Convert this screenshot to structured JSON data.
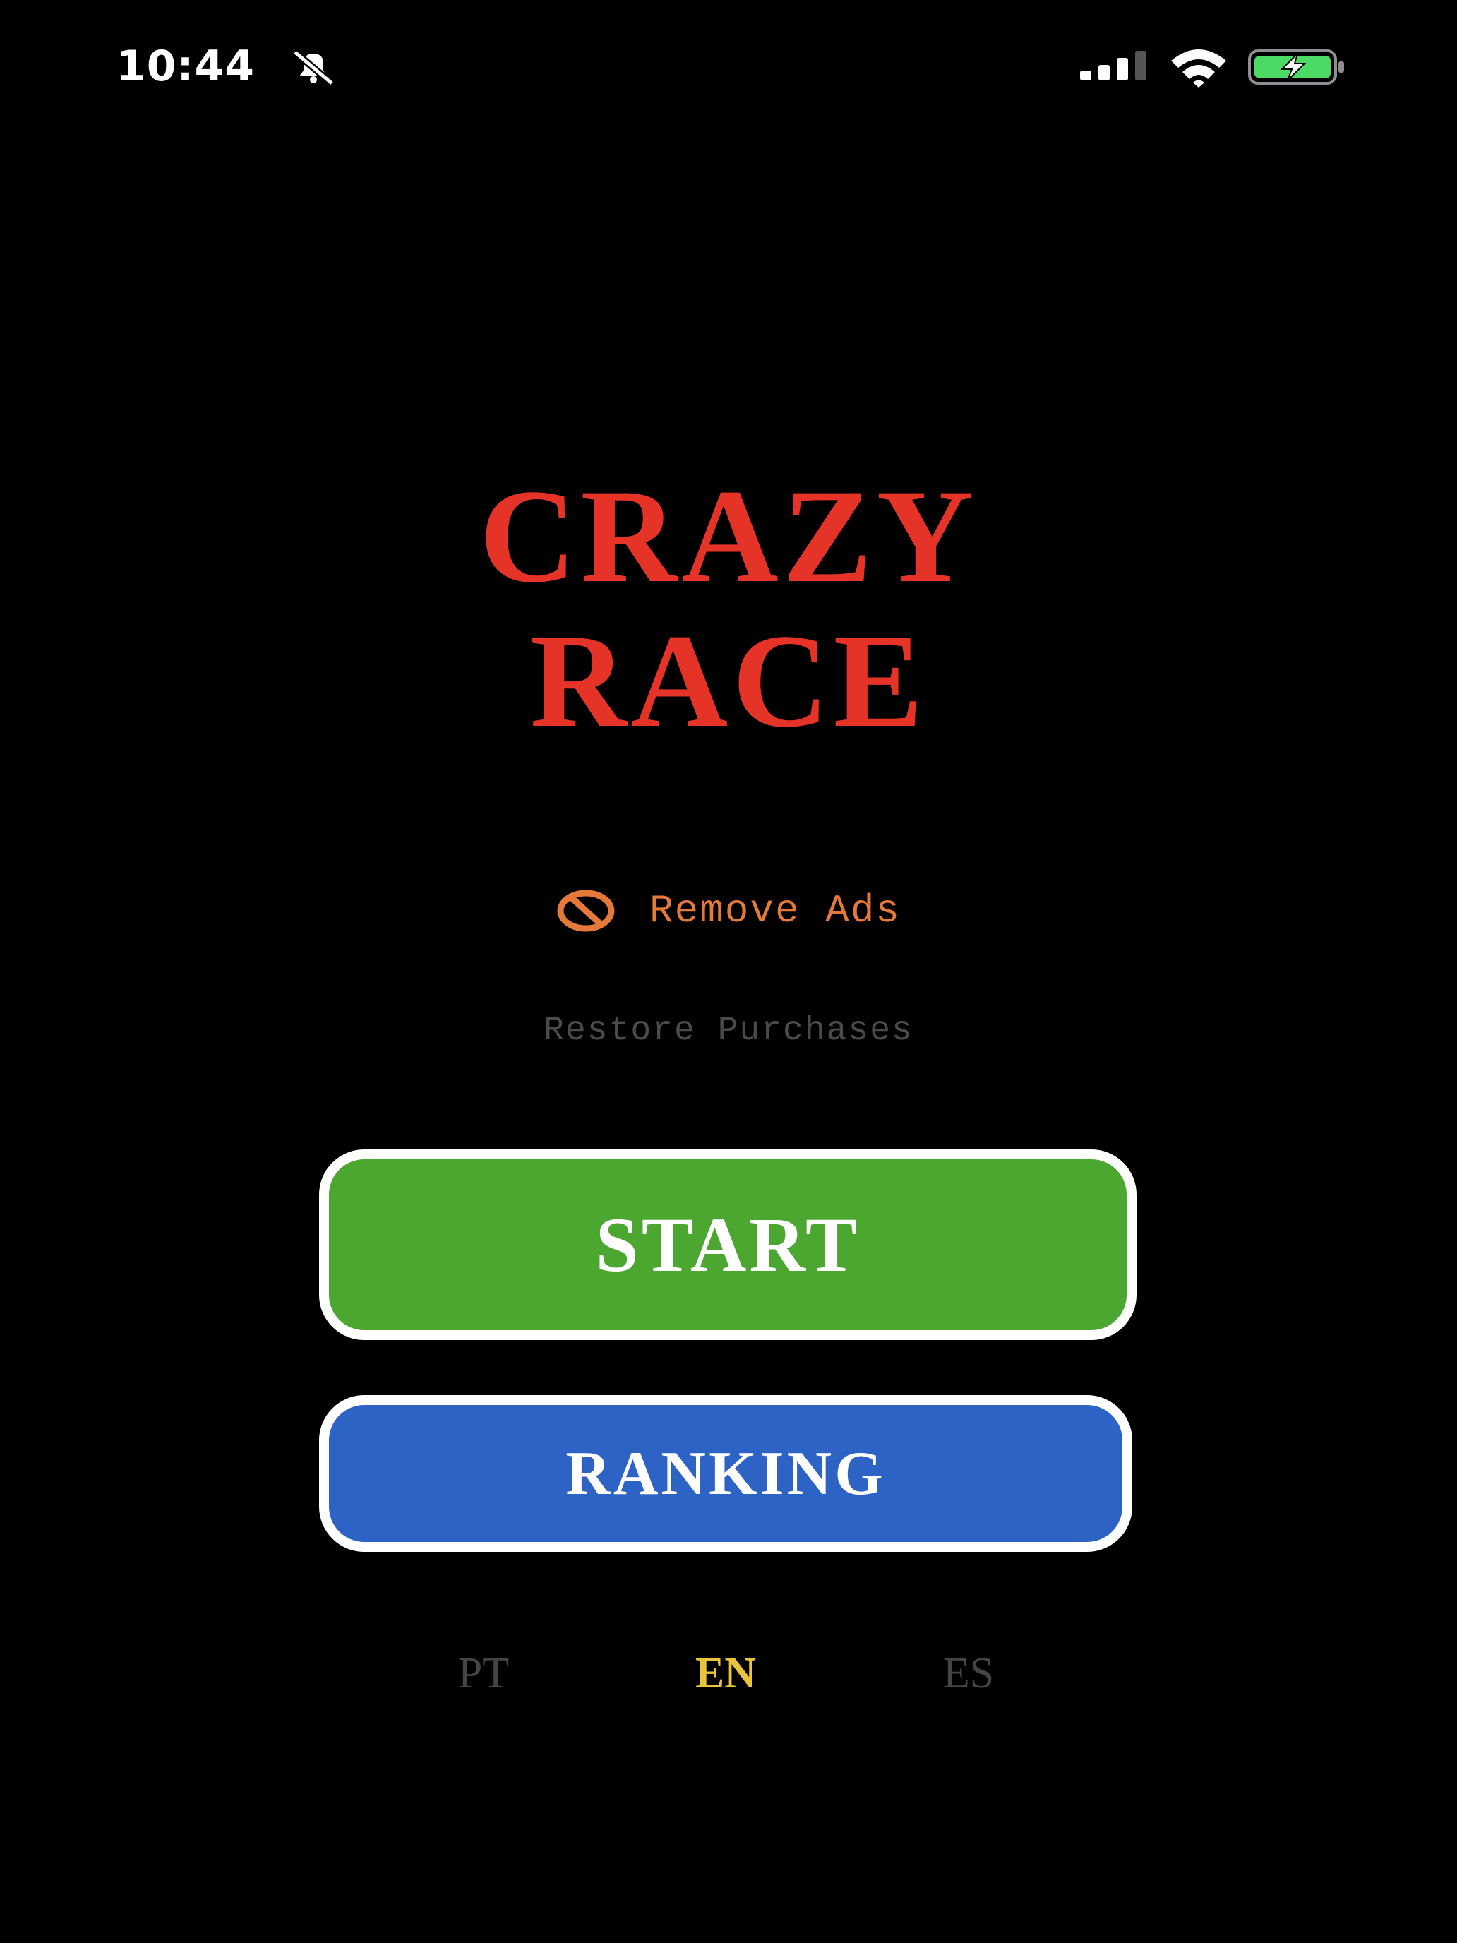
{
  "status_bar": {
    "time": "10:44",
    "icons": [
      "bell-slash-icon",
      "cellular-signal-icon",
      "wifi-icon",
      "battery-charging-icon"
    ],
    "battery_color": "#4cd964"
  },
  "game": {
    "title_line_1": "CRAZY",
    "title_line_2": "RACE",
    "title_color": "#e63328"
  },
  "menu": {
    "remove_ads_label": "Remove Ads",
    "remove_ads_icon": "no-entry-icon",
    "restore_purchases_label": "Restore Purchases",
    "start_label": "START",
    "ranking_label": "RANKING",
    "start_color": "#4ca731",
    "ranking_color": "#2e63c6"
  },
  "languages": {
    "options": [
      "PT",
      "EN",
      "ES"
    ],
    "selected": "EN",
    "selected_color": "#e8c53a"
  }
}
